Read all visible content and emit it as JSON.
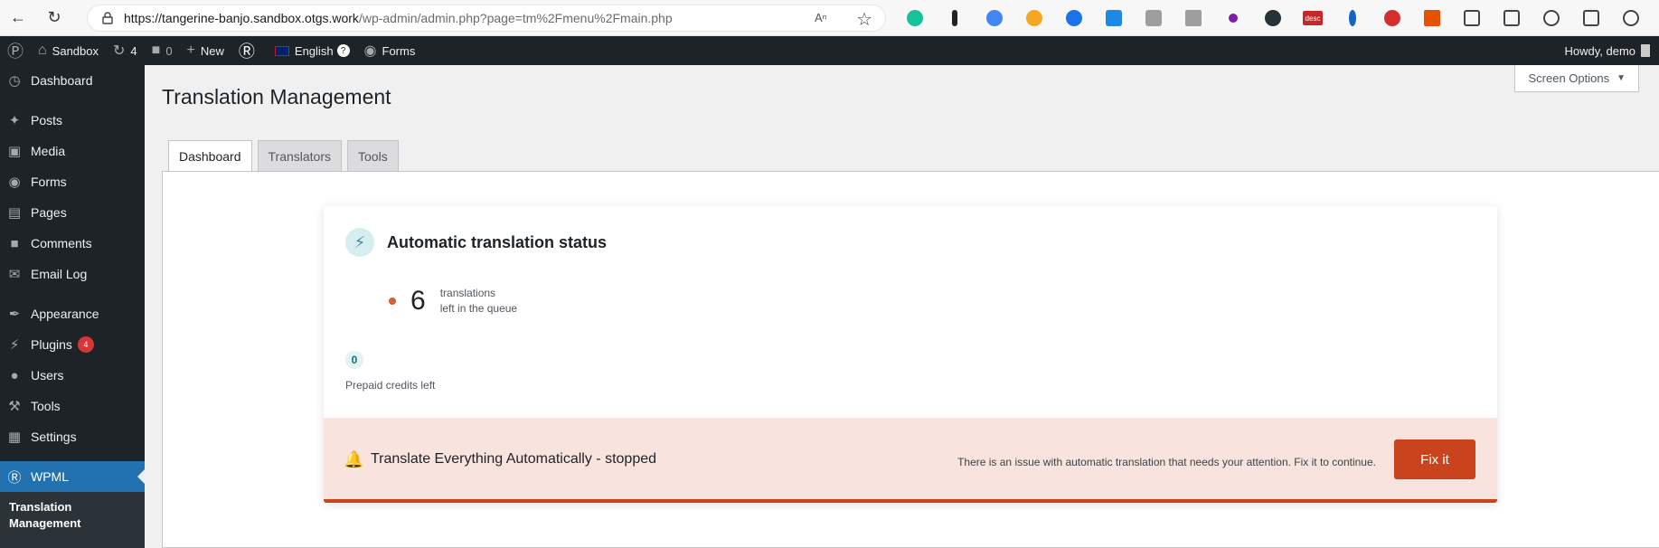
{
  "browser": {
    "url_host": "https://tangerine-banjo.sandbox.otgs.work",
    "url_path": "/wp-admin/admin.php?page=tm%2Fmenu%2Fmain.php",
    "ext_desc_label": "desc"
  },
  "adminbar": {
    "site": "Sandbox",
    "updates": "4",
    "comments": "0",
    "new": "New",
    "language": "English",
    "forms": "Forms",
    "howdy": "Howdy, demo"
  },
  "sidebar": {
    "items": [
      {
        "label": "Dashboard",
        "icon": "dashboard-icon"
      },
      {
        "label": "Posts",
        "icon": "pin-icon"
      },
      {
        "label": "Media",
        "icon": "media-icon"
      },
      {
        "label": "Forms",
        "icon": "forms-icon"
      },
      {
        "label": "Pages",
        "icon": "pages-icon"
      },
      {
        "label": "Comments",
        "icon": "comment-icon"
      },
      {
        "label": "Email Log",
        "icon": "email-icon"
      },
      {
        "label": "Appearance",
        "icon": "brush-icon"
      },
      {
        "label": "Plugins",
        "icon": "plugin-icon",
        "badge": "4"
      },
      {
        "label": "Users",
        "icon": "user-icon"
      },
      {
        "label": "Tools",
        "icon": "wrench-icon"
      },
      {
        "label": "Settings",
        "icon": "settings-icon"
      },
      {
        "label": "WPML",
        "icon": "wpml-icon"
      }
    ],
    "submenu_current": "Translation Management"
  },
  "screen_options": "Screen Options",
  "page_title": "Translation Management",
  "tabs": [
    "Dashboard",
    "Translators",
    "Tools"
  ],
  "card": {
    "title": "Automatic translation status",
    "queue_count": "6",
    "queue_label_1": "translations",
    "queue_label_2": "left in the queue",
    "credits": "0",
    "credits_label": "Prepaid credits left"
  },
  "alert": {
    "title": "Translate Everything Automatically - stopped",
    "message": "There is an issue with automatic translation that needs your attention. Fix it to continue.",
    "button": "Fix it"
  },
  "colors": {
    "accent": "#2271b1",
    "alert_bg": "#f8e3de",
    "alert_accent": "#c9431d"
  }
}
